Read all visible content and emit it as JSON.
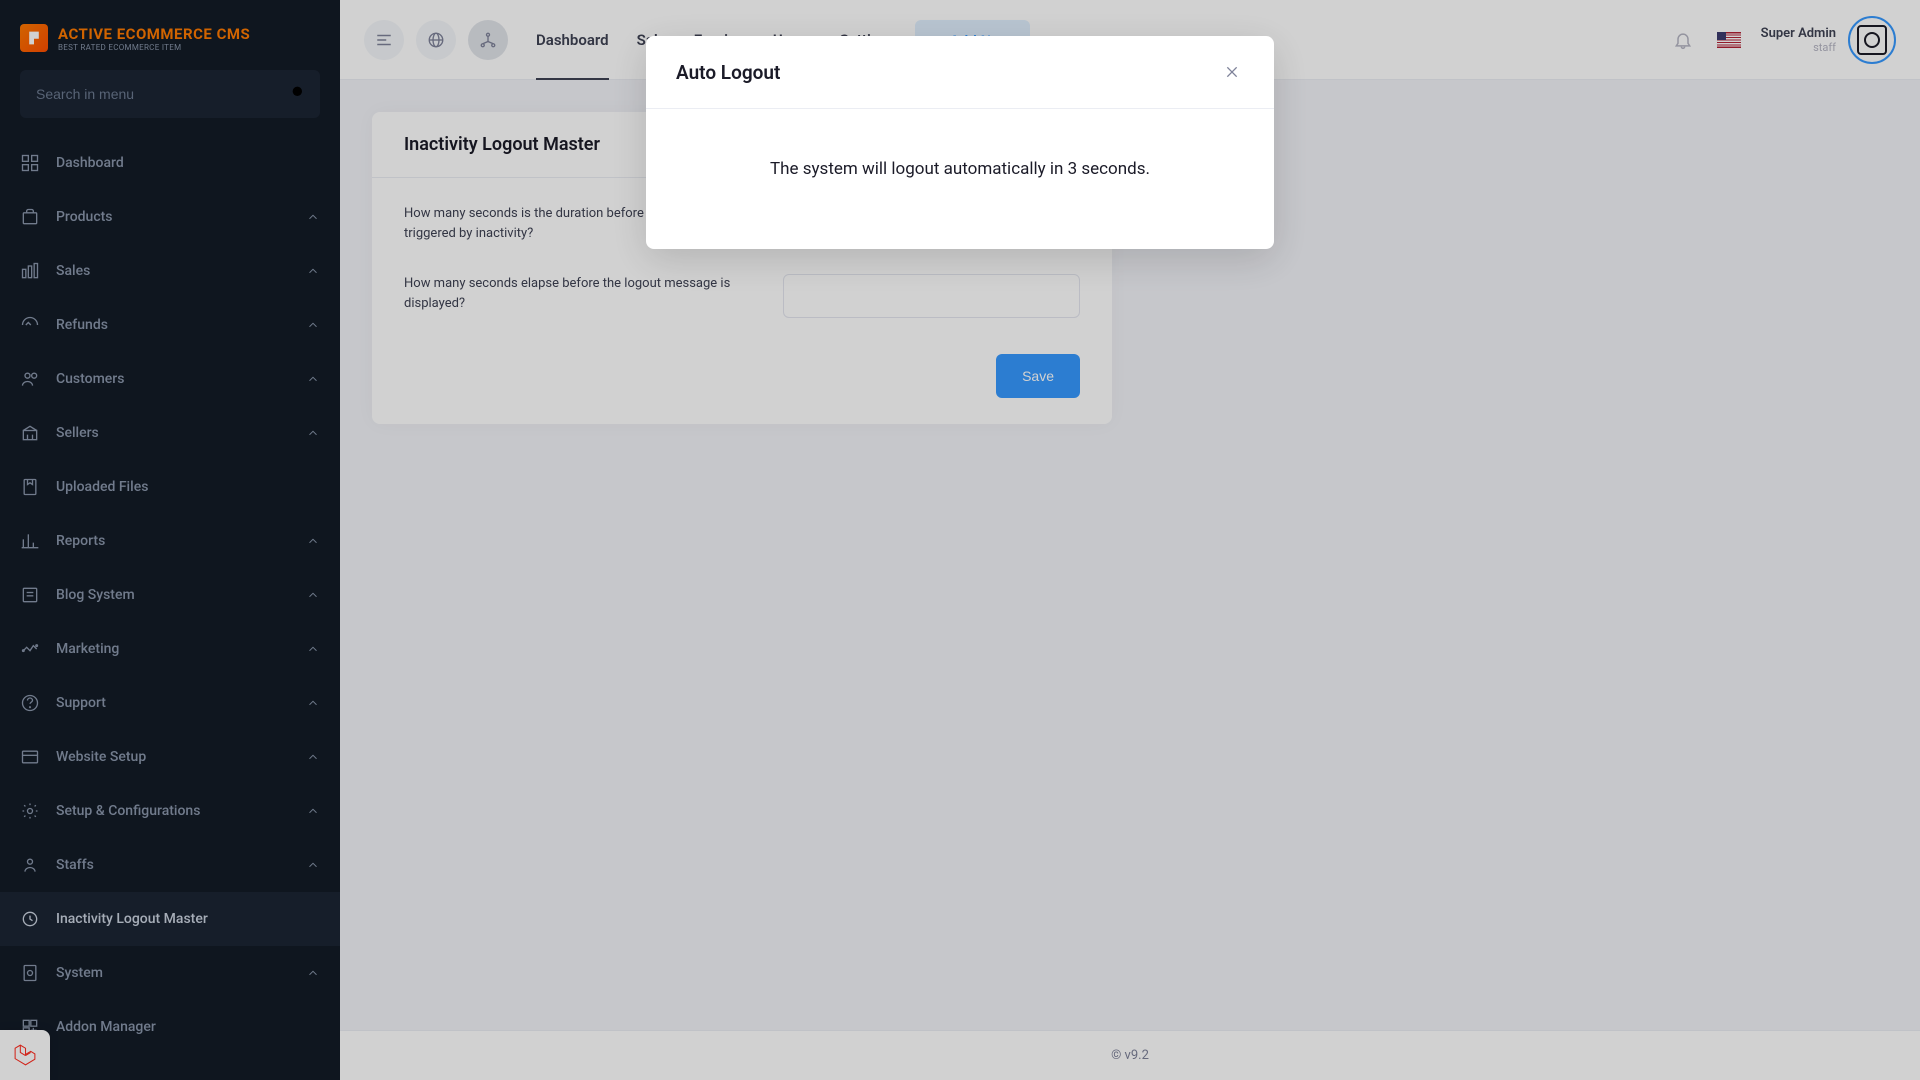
{
  "logo": {
    "line1": "ACTIVE ECOMMERCE CMS",
    "line2": "BEST RATED ECOMMERCE ITEM"
  },
  "search": {
    "placeholder": "Search in menu"
  },
  "sidebar": {
    "items": [
      {
        "label": "Dashboard",
        "expand": false
      },
      {
        "label": "Products",
        "expand": true
      },
      {
        "label": "Sales",
        "expand": true
      },
      {
        "label": "Refunds",
        "expand": true
      },
      {
        "label": "Customers",
        "expand": true
      },
      {
        "label": "Sellers",
        "expand": true
      },
      {
        "label": "Uploaded Files",
        "expand": false
      },
      {
        "label": "Reports",
        "expand": true
      },
      {
        "label": "Blog System",
        "expand": true
      },
      {
        "label": "Marketing",
        "expand": true
      },
      {
        "label": "Support",
        "expand": true
      },
      {
        "label": "Website Setup",
        "expand": true
      },
      {
        "label": "Setup & Configurations",
        "expand": true
      },
      {
        "label": "Staffs",
        "expand": true
      },
      {
        "label": "Inactivity Logout Master",
        "expand": false,
        "active": true
      },
      {
        "label": "System",
        "expand": true
      },
      {
        "label": "Addon Manager",
        "expand": false
      }
    ]
  },
  "header": {
    "tabs": [
      "Dashboard",
      "Sale",
      "Earning",
      "Users",
      "Settings"
    ],
    "add_btn": "Add New",
    "add_btn_plus": "+",
    "user_name": "Super Admin",
    "user_role": "staff"
  },
  "card": {
    "title": "Inactivity Logout Master",
    "q1": "How many seconds is the duration before the logout is triggered by inactivity?",
    "q2": "How many seconds elapse before the logout message is displayed?",
    "save": "Save"
  },
  "footer": {
    "text": "© v9.2"
  },
  "modal": {
    "title": "Auto Logout",
    "message": "The system will logout automatically in 3 seconds."
  }
}
